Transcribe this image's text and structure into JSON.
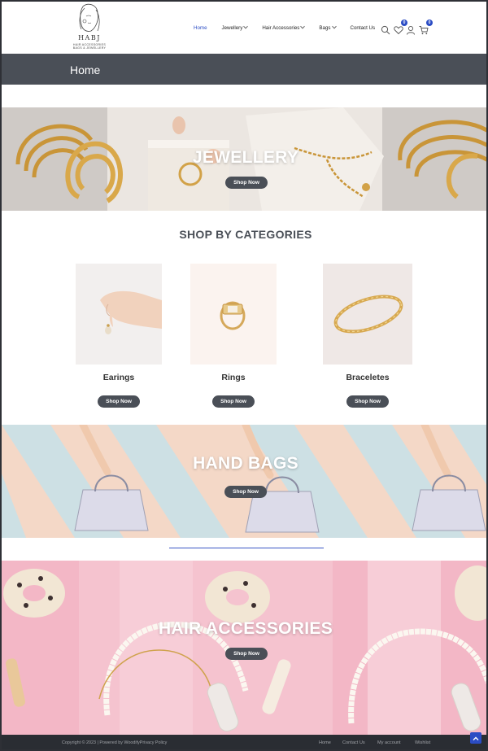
{
  "brand": {
    "name": "HABJ",
    "tagline_1": "HAIR ACCESSORIES",
    "tagline_2": "BAGS & JEWELLERY"
  },
  "nav": {
    "items": [
      {
        "label": "Home",
        "active": true,
        "dropdown": false
      },
      {
        "label": "Jewellery",
        "active": false,
        "dropdown": true
      },
      {
        "label": "Hair Accessories",
        "active": false,
        "dropdown": true
      },
      {
        "label": "Bags",
        "active": false,
        "dropdown": true
      },
      {
        "label": "Contact Us",
        "active": false,
        "dropdown": false
      }
    ]
  },
  "header_icons": {
    "search": "search-icon",
    "wishlist": "heart-icon",
    "wishlist_count": "0",
    "account": "user-icon",
    "cart": "cart-icon",
    "cart_count": "0"
  },
  "page_title": "Home",
  "banners": {
    "jewellery": {
      "title": "JEWELLERY",
      "button": "Shop Now"
    },
    "hand_bags": {
      "title": "HAND BAGS",
      "button": "Shop Now"
    },
    "hair_accessories": {
      "title": "HAIR ACCESSORIES",
      "button": "Shop Now"
    }
  },
  "categories": {
    "heading": "SHOP BY CATEGORIES",
    "items": [
      {
        "name": "Earings",
        "button": "Shop Now"
      },
      {
        "name": "Rings",
        "button": "Shop Now"
      },
      {
        "name": "Braceletes",
        "button": "Shop Now"
      }
    ]
  },
  "footer": {
    "copyright": "Copyright © 2023 | Powered by WoodifyPrivacy Policy",
    "links": [
      "Home",
      "Contact Us",
      "My account",
      "Wishlist"
    ]
  },
  "colors": {
    "accent": "#2b4cc4",
    "dark": "#4a4f57",
    "footer_bg": "#2a2d33"
  }
}
